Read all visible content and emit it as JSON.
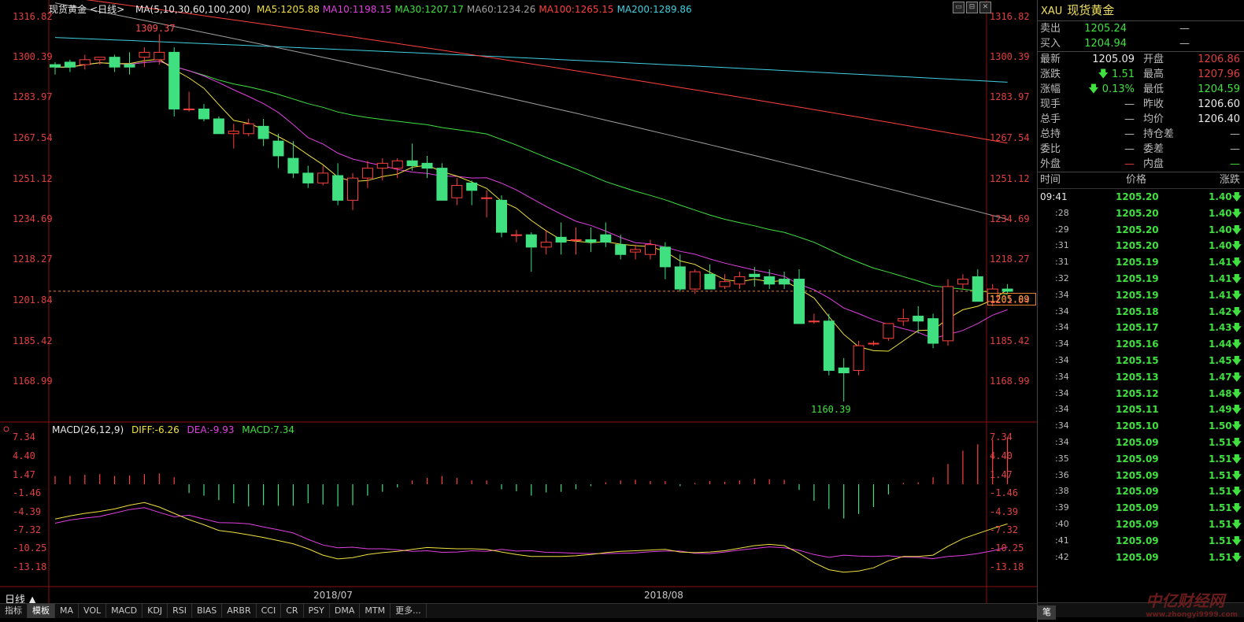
{
  "header": {
    "instrument": "现货黄金",
    "period_tag": "<日线>",
    "ma_params": "MA(5,10,30,60,100,200)",
    "ma_items": [
      {
        "text": "MA5:1205.88",
        "color": "#f0e040"
      },
      {
        "text": "MA10:1198.15",
        "color": "#e040e0"
      },
      {
        "text": "MA30:1207.17",
        "color": "#40e040"
      },
      {
        "text": "MA60:1234.26",
        "color": "#a0a0a0"
      },
      {
        "text": "MA100:1265.15",
        "color": "#ff4040"
      },
      {
        "text": "MA200:1289.86",
        "color": "#40d0e0"
      }
    ]
  },
  "window_buttons": [
    "▭",
    "⊟",
    "✕"
  ],
  "price_axis": [
    "1316.82",
    "1300.39",
    "1283.97",
    "1267.54",
    "1251.12",
    "1234.69",
    "1218.27",
    "1201.84",
    "1185.42",
    "1168.99"
  ],
  "current_price_tag": "1205.09",
  "annotations": {
    "high": "1309.37",
    "low": "1160.39"
  },
  "macd": {
    "title": "MACD(26,12,9)",
    "diff": "DIFF:-6.26",
    "dea": "DEA:-9.93",
    "macd": "MACD:7.34",
    "axis": [
      "7.34",
      "4.40",
      "1.47",
      "-1.46",
      "-4.39",
      "-7.32",
      "-10.25",
      "-13.18"
    ]
  },
  "dates": [
    "2018/07",
    "2018/08"
  ],
  "period_label": "日线 ▲",
  "tabs": [
    "指标",
    "模板",
    "MA",
    "VOL",
    "MACD",
    "KDJ",
    "RSI",
    "BIAS",
    "ARBR",
    "CCI",
    "CR",
    "PSY",
    "DMA",
    "MTM",
    "更多..."
  ],
  "active_tab": "模板",
  "chart_data": {
    "type": "candlestick",
    "ylim": [
      1160,
      1318
    ],
    "candles": [
      [
        1297,
        1298,
        1293,
        1296
      ],
      [
        1298,
        1299,
        1294,
        1296
      ],
      [
        1297,
        1301,
        1295,
        1299
      ],
      [
        1299,
        1300,
        1297,
        1300
      ],
      [
        1300,
        1301,
        1294,
        1296
      ],
      [
        1297,
        1302,
        1293,
        1296
      ],
      [
        1300,
        1304,
        1296,
        1302
      ],
      [
        1299,
        1309.37,
        1297,
        1302
      ],
      [
        1302,
        1304,
        1276,
        1279
      ],
      [
        1279,
        1286,
        1278,
        1279
      ],
      [
        1279,
        1281,
        1274,
        1275
      ],
      [
        1275,
        1276,
        1269,
        1269
      ],
      [
        1269,
        1273,
        1263,
        1270
      ],
      [
        1269,
        1275,
        1268,
        1273
      ],
      [
        1272,
        1275,
        1264,
        1267
      ],
      [
        1266,
        1269,
        1255,
        1260
      ],
      [
        1259,
        1266,
        1251,
        1253
      ],
      [
        1253,
        1256,
        1247,
        1249
      ],
      [
        1249,
        1256,
        1248,
        1253
      ],
      [
        1252,
        1257,
        1240,
        1242
      ],
      [
        1242,
        1253,
        1238,
        1251
      ],
      [
        1251,
        1258,
        1247,
        1255
      ],
      [
        1255,
        1259,
        1250,
        1257
      ],
      [
        1255,
        1259,
        1251,
        1258
      ],
      [
        1258,
        1265,
        1254,
        1256
      ],
      [
        1257,
        1260,
        1251,
        1255
      ],
      [
        1255,
        1257,
        1242,
        1242
      ],
      [
        1243,
        1251,
        1240,
        1248
      ],
      [
        1249,
        1250,
        1240,
        1246
      ],
      [
        1243,
        1246,
        1235,
        1243
      ],
      [
        1242,
        1244,
        1227,
        1229
      ],
      [
        1228,
        1230,
        1225,
        1228
      ],
      [
        1228,
        1229,
        1213,
        1223
      ],
      [
        1223,
        1230,
        1220,
        1225
      ],
      [
        1227,
        1233,
        1220,
        1225
      ],
      [
        1226,
        1231,
        1220,
        1226
      ],
      [
        1226,
        1231,
        1221,
        1225
      ],
      [
        1228,
        1233,
        1223,
        1225
      ],
      [
        1224,
        1228,
        1218,
        1220
      ],
      [
        1221,
        1224,
        1218,
        1222
      ],
      [
        1220,
        1226,
        1218,
        1224
      ],
      [
        1223,
        1225,
        1210,
        1215
      ],
      [
        1215,
        1220,
        1205,
        1206
      ],
      [
        1206,
        1214,
        1204,
        1213
      ],
      [
        1212,
        1216,
        1207,
        1206
      ],
      [
        1207,
        1212,
        1206,
        1209
      ],
      [
        1208,
        1213,
        1206,
        1211
      ],
      [
        1212,
        1215,
        1207,
        1211
      ],
      [
        1211,
        1214,
        1206,
        1208
      ],
      [
        1210,
        1213,
        1206,
        1208
      ],
      [
        1210,
        1214,
        1193,
        1192
      ],
      [
        1193,
        1196,
        1192,
        1193
      ],
      [
        1193,
        1196,
        1171,
        1173
      ],
      [
        1174,
        1178,
        1160.39,
        1172
      ],
      [
        1173,
        1185,
        1171,
        1183
      ],
      [
        1184,
        1185,
        1183,
        1184
      ],
      [
        1186,
        1192,
        1185,
        1192
      ],
      [
        1193,
        1198,
        1191,
        1194
      ],
      [
        1195,
        1199,
        1188,
        1193
      ],
      [
        1194,
        1196,
        1182,
        1184
      ],
      [
        1185,
        1210,
        1183,
        1207
      ],
      [
        1208,
        1212,
        1206,
        1210
      ],
      [
        1211,
        1214,
        1201,
        1201
      ],
      [
        1201,
        1208,
        1199,
        1206
      ],
      [
        1206,
        1208,
        1204,
        1205.09
      ]
    ],
    "histogram": [
      1.3,
      1.3,
      1.5,
      1.6,
      1.3,
      1.4,
      1.6,
      1.7,
      1.1,
      -1.4,
      -1.8,
      -2.5,
      -3.0,
      -3.5,
      -3.3,
      -3.4,
      -3.4,
      -3.0,
      -3.2,
      -3.5,
      -3.3,
      -1.8,
      -1.2,
      -0.5,
      0.6,
      1.0,
      1.3,
      1.0,
      0.6,
      0.6,
      -0.8,
      -1.1,
      -1.8,
      -1.3,
      -1.2,
      -0.8,
      -0.3,
      0.3,
      0.6,
      0.7,
      0.5,
      0.5,
      -0.3,
      0.2,
      0.5,
      0.4,
      0.6,
      0.9,
      0.8,
      0.7,
      -0.9,
      -2.6,
      -3.9,
      -5.4,
      -4.7,
      -3.6,
      -1.6,
      0.2,
      0.3,
      1.1,
      3.2,
      5.3,
      6.3,
      7.0,
      7.34
    ]
  },
  "panel": {
    "code": "XAU",
    "name": "现货黄金",
    "sell": {
      "label": "卖出",
      "value": "1205.24",
      "vol": "—"
    },
    "buy": {
      "label": "买入",
      "value": "1204.94",
      "vol": "—"
    },
    "quotes": [
      {
        "l1": "最新",
        "v1": "1205.09",
        "c1": "white",
        "l2": "开盘",
        "v2": "1206.86",
        "c2": "red"
      },
      {
        "l1": "涨跌",
        "v1": "🡇 1.51",
        "c1": "green",
        "l2": "最高",
        "v2": "1207.96",
        "c2": "red"
      },
      {
        "l1": "涨幅",
        "v1": "🡇 0.13%",
        "c1": "green",
        "l2": "最低",
        "v2": "1204.59",
        "c2": "green"
      },
      {
        "l1": "现手",
        "v1": "—",
        "c1": "gray",
        "l2": "昨收",
        "v2": "1206.60",
        "c2": "white"
      },
      {
        "l1": "总手",
        "v1": "—",
        "c1": "gray",
        "l2": "均价",
        "v2": "1206.40",
        "c2": "white"
      },
      {
        "l1": "总持",
        "v1": "—",
        "c1": "gray",
        "l2": "持仓差",
        "v2": "—",
        "c2": "gray"
      },
      {
        "l1": "委比",
        "v1": "—",
        "c1": "gray",
        "l2": "委差",
        "v2": "—",
        "c2": "gray"
      },
      {
        "l1": "外盘",
        "v1": "—",
        "c1": "red",
        "l2": "内盘",
        "v2": "—",
        "c2": "green"
      }
    ],
    "tick_headers": [
      "时间",
      "价格",
      "涨跌"
    ],
    "ticks": [
      {
        "t": "09:41",
        "p": "1205.20",
        "c": "1.40🡇"
      },
      {
        "t": ":28",
        "p": "1205.20",
        "c": "1.40🡇"
      },
      {
        "t": ":29",
        "p": "1205.20",
        "c": "1.40🡇"
      },
      {
        "t": ":31",
        "p": "1205.20",
        "c": "1.40🡇"
      },
      {
        "t": ":31",
        "p": "1205.19",
        "c": "1.41🡇"
      },
      {
        "t": ":32",
        "p": "1205.19",
        "c": "1.41🡇"
      },
      {
        "t": ":34",
        "p": "1205.19",
        "c": "1.41🡇"
      },
      {
        "t": ":34",
        "p": "1205.18",
        "c": "1.42🡇"
      },
      {
        "t": ":34",
        "p": "1205.17",
        "c": "1.43🡇"
      },
      {
        "t": ":34",
        "p": "1205.16",
        "c": "1.44🡇"
      },
      {
        "t": ":34",
        "p": "1205.15",
        "c": "1.45🡇"
      },
      {
        "t": ":34",
        "p": "1205.13",
        "c": "1.47🡇"
      },
      {
        "t": ":34",
        "p": "1205.12",
        "c": "1.48🡇"
      },
      {
        "t": ":34",
        "p": "1205.11",
        "c": "1.49🡇"
      },
      {
        "t": ":34",
        "p": "1205.10",
        "c": "1.50🡇"
      },
      {
        "t": ":34",
        "p": "1205.09",
        "c": "1.51🡇"
      },
      {
        "t": ":35",
        "p": "1205.09",
        "c": "1.51🡇"
      },
      {
        "t": ":36",
        "p": "1205.09",
        "c": "1.51🡇"
      },
      {
        "t": ":38",
        "p": "1205.09",
        "c": "1.51🡇"
      },
      {
        "t": ":39",
        "p": "1205.09",
        "c": "1.51🡇"
      },
      {
        "t": ":40",
        "p": "1205.09",
        "c": "1.51🡇"
      },
      {
        "t": ":41",
        "p": "1205.09",
        "c": "1.51🡇"
      },
      {
        "t": ":42",
        "p": "1205.09",
        "c": "1.51🡇"
      }
    ],
    "footer_tab": "笔"
  },
  "watermark": {
    "main": "中亿财经网",
    "sub": "www.zhongyi9999.com"
  }
}
